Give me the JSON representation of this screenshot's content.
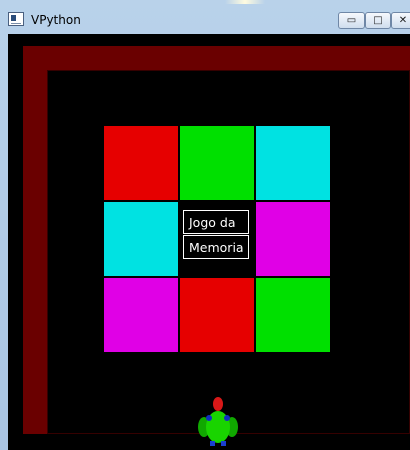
{
  "window": {
    "title": "VPython",
    "controls": {
      "minimize": "▭",
      "maximize": "□",
      "close": "✕"
    }
  },
  "scene": {
    "background": "#000000",
    "frame_color": "#6a0000",
    "cards": [
      "#e60000",
      "#00e000",
      "#00e2e2",
      "#00e2e2",
      "#000000",
      "#e000e6",
      "#e000e6",
      "#e60000",
      "#00e000"
    ],
    "label": {
      "line1": "Jogo da",
      "line2": "Memoria"
    },
    "character": {
      "body_color": "#19d400",
      "head_color": "#d81818"
    }
  }
}
